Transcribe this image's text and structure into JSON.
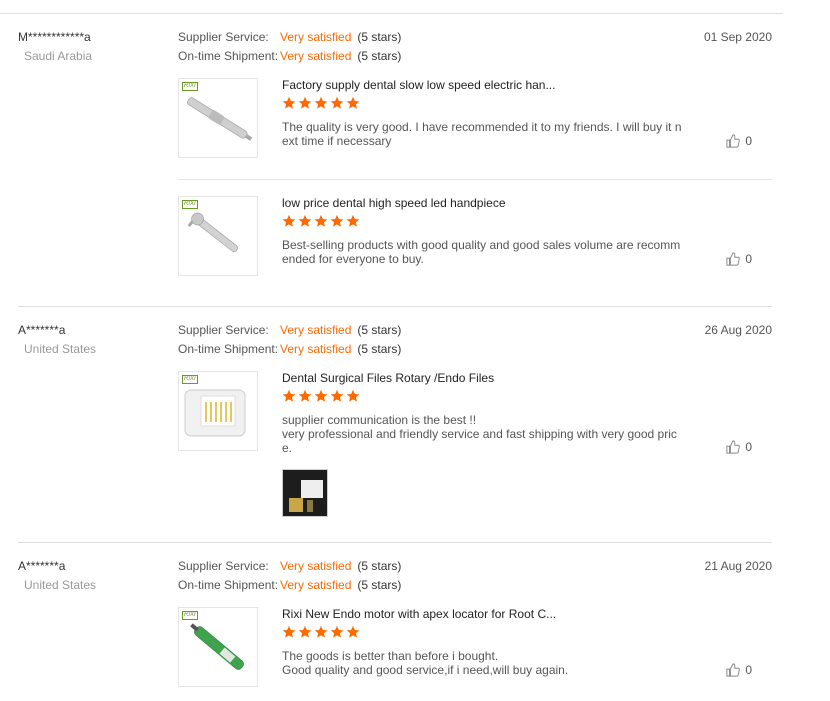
{
  "colors": {
    "accent": "#ff6a00",
    "star": "#ff6a00"
  },
  "reviews": [
    {
      "buyer": "M************a",
      "country": "Saudi Arabia",
      "date": "01 Sep 2020",
      "supplier_label": "Supplier Service:",
      "supplier_value": "Very satisfied",
      "supplier_stars": "(5 stars)",
      "shipment_label": "On-time Shipment:",
      "shipment_value": "Very satisfied",
      "shipment_stars": "(5 stars)",
      "products": [
        {
          "title": "Factory supply dental slow low speed electric han...",
          "rating": 5,
          "comment": "The quality is very good. I have recommended it to my friends. I will buy it next time if necessary",
          "likes": "0",
          "thumb_icon": "handpiece-straight"
        },
        {
          "title": "low price dental high speed led handpiece",
          "rating": 5,
          "comment": "Best-selling products with good quality and good sales volume are recommended for everyone to buy.",
          "likes": "0",
          "thumb_icon": "handpiece-highspeed"
        }
      ]
    },
    {
      "buyer": "A*******a",
      "country": "United States",
      "date": "26 Aug 2020",
      "supplier_label": "Supplier Service:",
      "supplier_value": "Very satisfied",
      "supplier_stars": "(5 stars)",
      "shipment_label": "On-time Shipment:",
      "shipment_value": "Very satisfied",
      "shipment_stars": "(5 stars)",
      "products": [
        {
          "title": "Dental Surgical Files Rotary /Endo Files",
          "rating": 5,
          "comment": "supplier communication is the best !!\nvery professional and friendly service and fast shipping with very good price.",
          "likes": "0",
          "thumb_icon": "endo-files-box"
        }
      ]
    },
    {
      "buyer": "A*******a",
      "country": "United States",
      "date": "21 Aug 2020",
      "supplier_label": "Supplier Service:",
      "supplier_value": "Very satisfied",
      "supplier_stars": "(5 stars)",
      "shipment_label": "On-time Shipment:",
      "shipment_value": "Very satisfied",
      "shipment_stars": "(5 stars)",
      "products": [
        {
          "title": "Rixi New Endo motor with apex locator for Root C...",
          "rating": 5,
          "comment": "The goods is better than before i bought.\nGood quality and good service,if i need,will buy again.",
          "likes": "0",
          "thumb_icon": "endo-motor"
        }
      ]
    }
  ],
  "logo_text": "RIXI"
}
